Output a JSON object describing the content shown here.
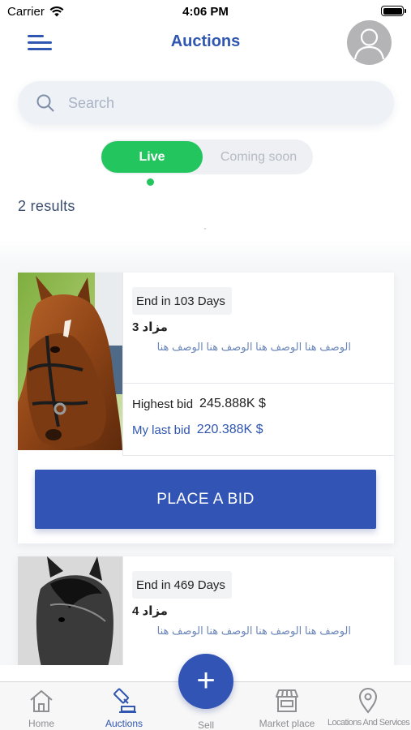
{
  "status_bar": {
    "carrier": "Carrier",
    "time": "4:06 PM"
  },
  "header": {
    "title": "Auctions",
    "menu_icon": "hamburger-menu-icon",
    "avatar_icon": "user-avatar-icon"
  },
  "search": {
    "placeholder": "Search",
    "value": "",
    "icon": "search-icon"
  },
  "tabs": {
    "live": "Live",
    "coming_soon": "Coming soon",
    "selected": "Live"
  },
  "results_text": "2 results",
  "auctions": [
    {
      "end_label": "End in",
      "end_value": "103 Days",
      "title": "مزاد 3",
      "description": "الوصف هنا الوصف هنا الوصف هنا الوصف هنا",
      "highest_bid_label": "Highest bid",
      "highest_bid_value": "245.888K $",
      "my_last_bid_label": "My last bid",
      "my_last_bid_value": "220.388K $",
      "button_label": "PLACE A BID",
      "image": "brown-horse-photo"
    },
    {
      "end_label": "End in",
      "end_value": "469 Days",
      "title": "مزاد 4",
      "description": "الوصف هنا الوصف هنا الوصف هنا الوصف هنا",
      "image": "black-white-horse-photo"
    }
  ],
  "fab": {
    "symbol": "+",
    "icon": "plus-icon"
  },
  "tabbar": [
    {
      "label": "Home",
      "icon": "home-icon"
    },
    {
      "label": "Auctions",
      "icon": "gavel-icon",
      "active": true
    },
    {
      "label": "Sell",
      "icon": "plus-icon"
    },
    {
      "label": "Market place",
      "icon": "store-icon"
    },
    {
      "label": "Locations And Services",
      "icon": "location-pin-icon"
    }
  ],
  "colors": {
    "primary": "#3255b5",
    "title_blue": "#2f56b0",
    "live_green": "#22c55e",
    "desc_blue": "#6a86b8"
  }
}
